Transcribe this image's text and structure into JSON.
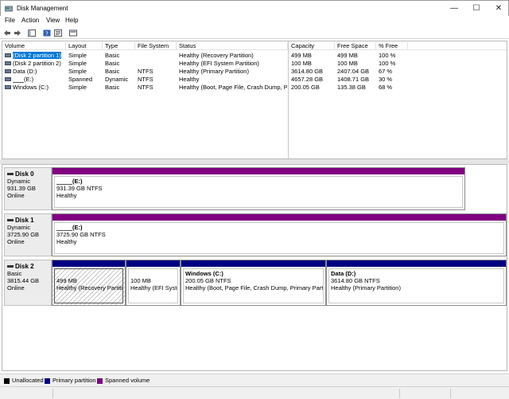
{
  "window": {
    "title": "Disk Management"
  },
  "menu": [
    "File",
    "Action",
    "View",
    "Help"
  ],
  "window_buttons": {
    "minimize": "—",
    "maximize": "☐",
    "close": "✕"
  },
  "table": {
    "columns": [
      "Volume",
      "Layout",
      "Type",
      "File System",
      "Status",
      "Capacity",
      "Free Space",
      "% Free"
    ],
    "rows": [
      {
        "volume": "(Disk 2 partition 1)",
        "layout": "Simple",
        "type": "Basic",
        "fs": "",
        "status": "Healthy (Recovery Partition)",
        "capacity": "499 MB",
        "free": "499 MB",
        "pct": "100 %"
      },
      {
        "volume": "(Disk 2 partition 2)",
        "layout": "Simple",
        "type": "Basic",
        "fs": "",
        "status": "Healthy (EFI System Partition)",
        "capacity": "100 MB",
        "free": "100 MB",
        "pct": "100 %"
      },
      {
        "volume": "Data (D:)",
        "layout": "Simple",
        "type": "Basic",
        "fs": "NTFS",
        "status": "Healthy (Primary Partition)",
        "capacity": "3614.80 GB",
        "free": "2407.04 GB",
        "pct": "67 %"
      },
      {
        "volume": "(E:)",
        "layout": "Spanned",
        "type": "Dynamic",
        "fs": "NTFS",
        "status": "Healthy",
        "capacity": "4657.28 GB",
        "free": "1408.71 GB",
        "pct": "30 %"
      },
      {
        "volume": "Windows (C:)",
        "layout": "Simple",
        "type": "Basic",
        "fs": "NTFS",
        "status": "Healthy (Boot, Page File, Crash Dump, P...",
        "capacity": "200.05 GB",
        "free": "135.38 GB",
        "pct": "68 %"
      }
    ]
  },
  "disks": [
    {
      "name": "Disk 0",
      "type": "Dynamic",
      "size": "931.39 GB",
      "state": "Online",
      "partitions": [
        {
          "label": "(E:)",
          "detail": "931.39 GB NTFS",
          "status": "Healthy"
        }
      ]
    },
    {
      "name": "Disk 1",
      "type": "Dynamic",
      "size": "3725.90 GB",
      "state": "Online",
      "partitions": [
        {
          "label": "(E:)",
          "detail": "3725.90 GB NTFS",
          "status": "Healthy"
        }
      ]
    },
    {
      "name": "Disk 2",
      "type": "Basic",
      "size": "3815.44 GB",
      "state": "Online",
      "partitions": [
        {
          "label": "",
          "detail": "499 MB",
          "status": "Healthy (Recovery Partitio"
        },
        {
          "label": "",
          "detail": "100 MB",
          "status": "Healthy (EFI Syster"
        },
        {
          "label": "Windows  (C:)",
          "detail": "200.05 GB NTFS",
          "status": "Healthy (Boot, Page File, Crash Dump, Primary Partitio"
        },
        {
          "label": "Data  (D:)",
          "detail": "3614.80 GB NTFS",
          "status": "Healthy (Primary Partition)"
        }
      ]
    }
  ],
  "legend": [
    "Unallocated",
    "Primary partition",
    "Spanned volume"
  ],
  "colors": {
    "spanned": "#800080",
    "primary": "#000080",
    "unallocated": "#000000",
    "selection": "#0078d7"
  }
}
